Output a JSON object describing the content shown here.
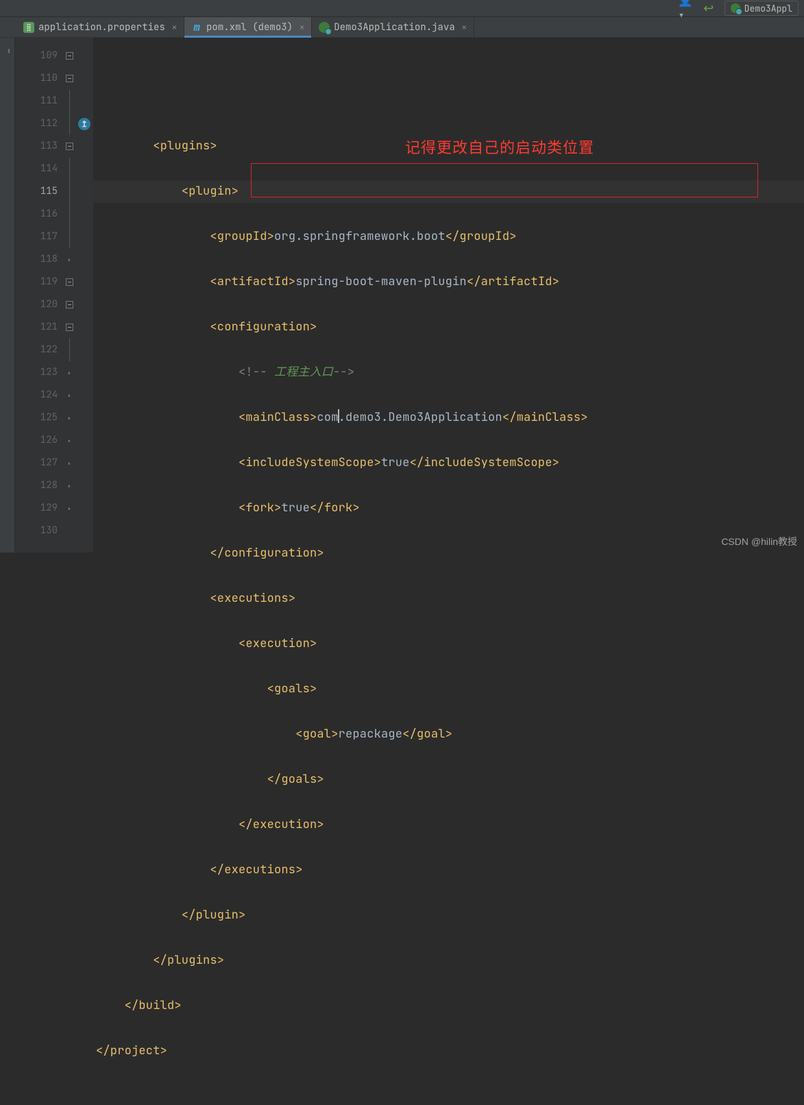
{
  "toolbar": {
    "run_config_label": "Demo3Appl"
  },
  "tabs": [
    {
      "label": "application.properties",
      "type": "prop",
      "active": false,
      "name": "tab-application-properties"
    },
    {
      "label": "pom.xml (demo3)",
      "type": "mvn",
      "active": true,
      "name": "tab-pom-xml"
    },
    {
      "label": "Demo3Application.java",
      "type": "java",
      "active": false,
      "name": "tab-demo3application"
    }
  ],
  "gutter": {
    "start": 109,
    "end": 130,
    "current": 115
  },
  "code": {
    "l109": {
      "full": "<plugins>"
    },
    "l110": {
      "full": "<plugin>"
    },
    "l111": {
      "open": "<groupId>",
      "val": "org.springframework.boot",
      "close": "</groupId>"
    },
    "l112": {
      "open": "<artifactId>",
      "val": "spring-boot-maven-plugin",
      "close": "</artifactId>"
    },
    "l113": {
      "full": "<configuration>"
    },
    "l114": {
      "open": "<!-- ",
      "lbl": "工程主入口",
      "close": "-->"
    },
    "l115": {
      "open": "<mainClass>",
      "val_a": "com",
      "val_b": ".demo3.Demo3Application",
      "close": "</mainClass>"
    },
    "l116": {
      "open": "<includeSystemScope>",
      "val": "true",
      "close": "</includeSystemScope>"
    },
    "l117": {
      "open": "<fork>",
      "val": "true",
      "close": "</fork>"
    },
    "l118": {
      "full": "</configuration>"
    },
    "l119": {
      "full": "<executions>"
    },
    "l120": {
      "full": "<execution>"
    },
    "l121": {
      "full": "<goals>"
    },
    "l122": {
      "open": "<goal>",
      "val": "repackage",
      "close": "</goal>"
    },
    "l123": {
      "full": "</goals>"
    },
    "l124": {
      "full": "</execution>"
    },
    "l125": {
      "full": "</executions>"
    },
    "l126": {
      "full": "</plugin>"
    },
    "l127": {
      "full": "</plugins>"
    },
    "l128": {
      "full": "</build>"
    },
    "l129": {
      "full": "</project>"
    }
  },
  "annotation": "记得更改自己的启动类位置",
  "watermark": "CSDN @hilin教授"
}
